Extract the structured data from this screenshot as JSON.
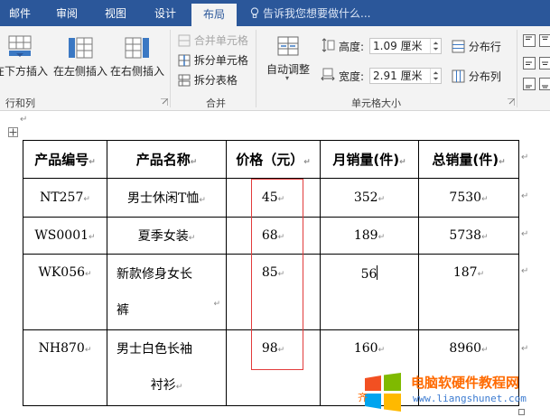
{
  "tabs": [
    {
      "label": "邮件",
      "active": false
    },
    {
      "label": "审阅",
      "active": false
    },
    {
      "label": "视图",
      "active": false
    },
    {
      "label": "设计",
      "active": false
    },
    {
      "label": "布局",
      "active": true
    }
  ],
  "tell_me": "告诉我您想要做什么...",
  "ribbon": {
    "rows_cols": {
      "insert_below": "在下方插入",
      "insert_left": "在左侧插入",
      "insert_right": "在右侧插入",
      "group_label": "行和列"
    },
    "merge": {
      "merge_cells": "合并单元格",
      "split_cells": "拆分单元格",
      "split_table": "拆分表格",
      "group_label": "合并"
    },
    "cell_size": {
      "autofit": "自动调整",
      "height_label": "高度:",
      "height_value": "1.09 厘米",
      "width_label": "宽度:",
      "width_value": "2.91 厘米",
      "distribute_rows": "分布行",
      "distribute_cols": "分布列",
      "group_label": "单元格大小"
    }
  },
  "table": {
    "headers": [
      "产品编号",
      "产品名称",
      "价格（元）",
      "月销量(件)",
      "总销量(件)"
    ],
    "rows": [
      {
        "id": "NT257",
        "name": "男士休闲T恤",
        "price": "45",
        "monthly": "352",
        "total": "7530"
      },
      {
        "id": "WS0001",
        "name": "夏季女装",
        "price": "68",
        "monthly": "189",
        "total": "5738"
      },
      {
        "id": "WK056",
        "name_line1": "新款修身女长",
        "name_line2": "裤",
        "price": "85",
        "monthly": "56",
        "total": "187"
      },
      {
        "id": "NH870",
        "name_line1": "男士白色长袖",
        "name_line2": "衬衫",
        "price": "98",
        "monthly": "160",
        "total": "8960"
      }
    ]
  },
  "watermark": {
    "title": "电脑软硬件教程网",
    "url": "www.liangshunet.com",
    "fragment": "齐"
  },
  "colors": {
    "accent": "#2b579a",
    "highlight_box": "#e23b3b",
    "watermark_orange": "#ff6a00",
    "watermark_blue": "#3d7cd1"
  },
  "icons": {
    "tell_me": "lightbulb-icon",
    "insert_below": "insert-row-below-icon",
    "insert_left": "insert-column-left-icon",
    "insert_right": "insert-column-right-icon",
    "merge": "merge-cells-icon",
    "split_cells": "split-cells-icon",
    "split_table": "split-table-icon",
    "autofit": "autofit-icon",
    "height": "row-height-icon",
    "width": "column-width-icon",
    "distribute_rows": "distribute-rows-icon",
    "distribute_cols": "distribute-columns-icon",
    "paragraph_mark": "paragraph-mark-icon",
    "table_move": "table-move-handle-icon"
  }
}
